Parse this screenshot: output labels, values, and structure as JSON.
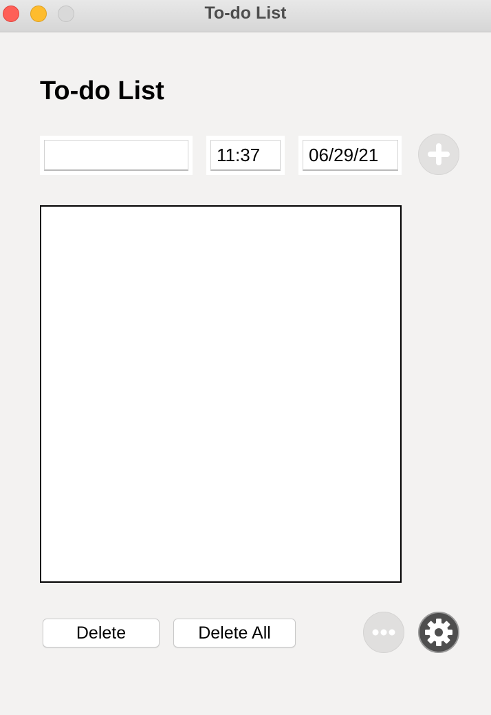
{
  "window": {
    "title": "To-do List"
  },
  "header": {
    "title": "To-do List"
  },
  "form": {
    "task_value": "",
    "time_value": "11:37",
    "date_value": "06/29/21",
    "add_icon": "plus-circle-icon"
  },
  "list": {
    "items": []
  },
  "footer": {
    "delete_label": "Delete",
    "delete_all_label": "Delete All",
    "more_icon": "ellipsis-icon",
    "settings_icon": "gear-icon"
  },
  "colors": {
    "background": "#f3f2f1",
    "close": "#fe5f57",
    "minimize": "#febc2e",
    "zoom_disabled": "#d9d9d9",
    "settings_button": "#4e4e4e",
    "disabled_button": "#e2e1e0"
  }
}
